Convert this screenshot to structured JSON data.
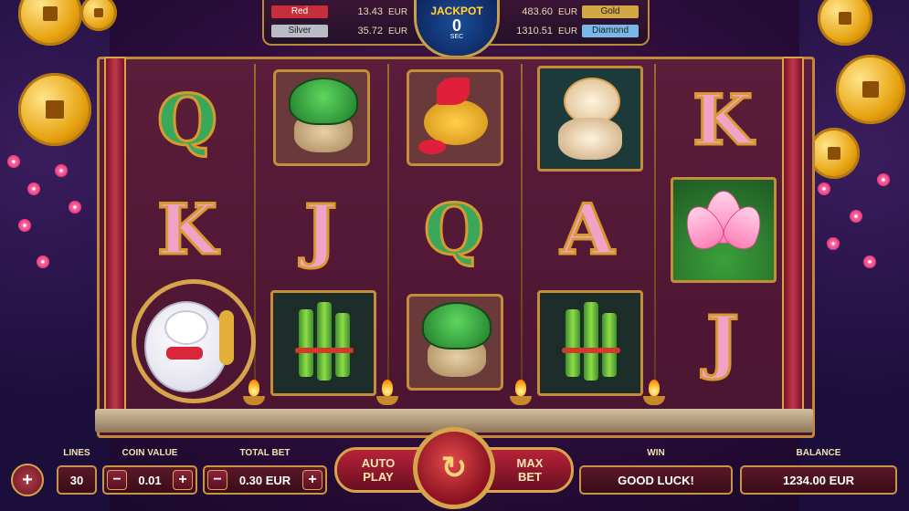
{
  "jackpots": {
    "red": {
      "label": "Red",
      "amount": "13.43",
      "currency": "EUR",
      "color": "#c62e3c"
    },
    "silver": {
      "label": "Silver",
      "amount": "35.72",
      "currency": "EUR",
      "color": "#b9bcc4"
    },
    "gold": {
      "label": "Gold",
      "amount": "483.60",
      "currency": "EUR",
      "color": "#d2a844"
    },
    "diamond": {
      "label": "Diamond",
      "amount": "1310.51",
      "currency": "EUR",
      "color": "#78b8e8"
    },
    "main": {
      "title": "JACKPOT",
      "countdown": "0",
      "unit": "SEC"
    }
  },
  "reels": [
    [
      "Q",
      "K",
      "lucky-cat"
    ],
    [
      "turtle",
      "J",
      "bamboo"
    ],
    [
      "koi-fish",
      "Q",
      "turtle"
    ],
    [
      "foo-dog",
      "A",
      "bamboo"
    ],
    [
      "K",
      "lotus",
      "J"
    ]
  ],
  "controls": {
    "lines_label": "LINES",
    "lines_value": "30",
    "coin_value_label": "COIN VALUE",
    "coin_value": "0.01",
    "total_bet_label": "TOTAL BET",
    "total_bet": "0.30 EUR",
    "autoplay_label": "AUTO PLAY",
    "maxbet_label": "MAX BET",
    "win_label": "WIN",
    "win_message": "GOOD LUCK!",
    "balance_label": "BALANCE",
    "balance": "1234.00 EUR",
    "minus": "−",
    "plus": "+"
  },
  "icons": {
    "spin": "spin-arrow-icon",
    "add": "plus-icon"
  }
}
